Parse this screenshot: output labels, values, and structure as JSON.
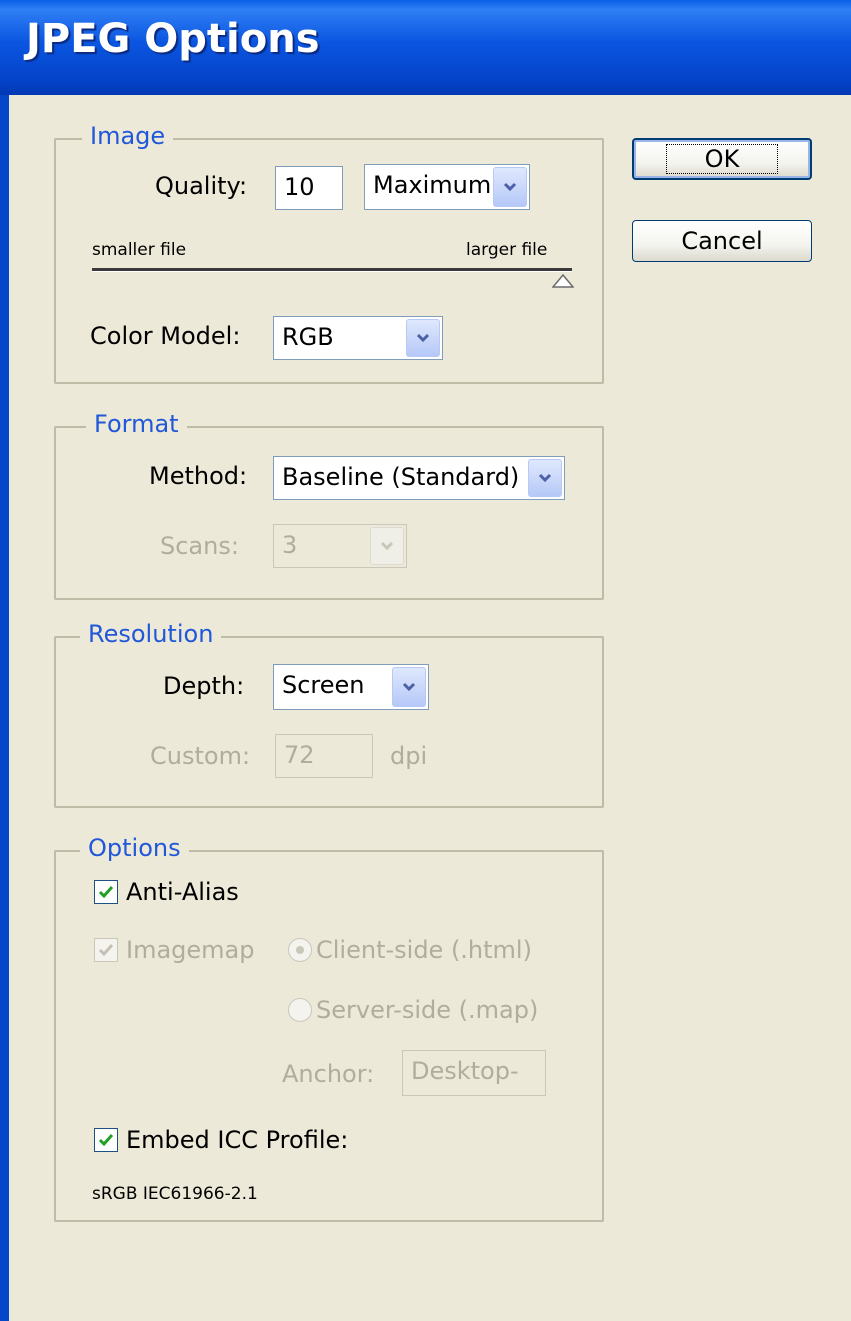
{
  "window": {
    "title": "JPEG Options"
  },
  "image_group": {
    "legend": "Image",
    "quality_label": "Quality:",
    "quality_value": "10",
    "quality_preset": "Maximum",
    "slider_left": "smaller file",
    "slider_right": "larger file",
    "slider_level": 1.0,
    "color_model_label": "Color Model:",
    "color_model_value": "RGB"
  },
  "format_group": {
    "legend": "Format",
    "method_label": "Method:",
    "method_value": "Baseline (Standard)",
    "scans_label": "Scans:",
    "scans_value": "3"
  },
  "resolution_group": {
    "legend": "Resolution",
    "depth_label": "Depth:",
    "depth_value": "Screen",
    "custom_label": "Custom:",
    "custom_value": "72",
    "custom_unit": "dpi"
  },
  "options_group": {
    "legend": "Options",
    "anti_alias_label": "Anti-Alias",
    "anti_alias_checked": true,
    "imagemap_label": "Imagemap",
    "imagemap_checked": true,
    "client_side_label": "Client-side (.html)",
    "server_side_label": "Server-side (.map)",
    "anchor_label": "Anchor:",
    "anchor_value": "Desktop-",
    "embed_icc_label": "Embed ICC Profile:",
    "embed_icc_checked": true,
    "icc_profile_name": "sRGB IEC61966-2.1"
  },
  "buttons": {
    "ok": "OK",
    "cancel": "Cancel"
  },
  "colors": {
    "title_bar": "#0a55e0",
    "legend": "#2157d9",
    "dialog_bg": "#ece9d8",
    "check": "#21a121"
  },
  "icons": {
    "dropdown": "chevron-down-icon",
    "check": "checkmark-icon",
    "slider": "triangle-thumb-icon"
  }
}
